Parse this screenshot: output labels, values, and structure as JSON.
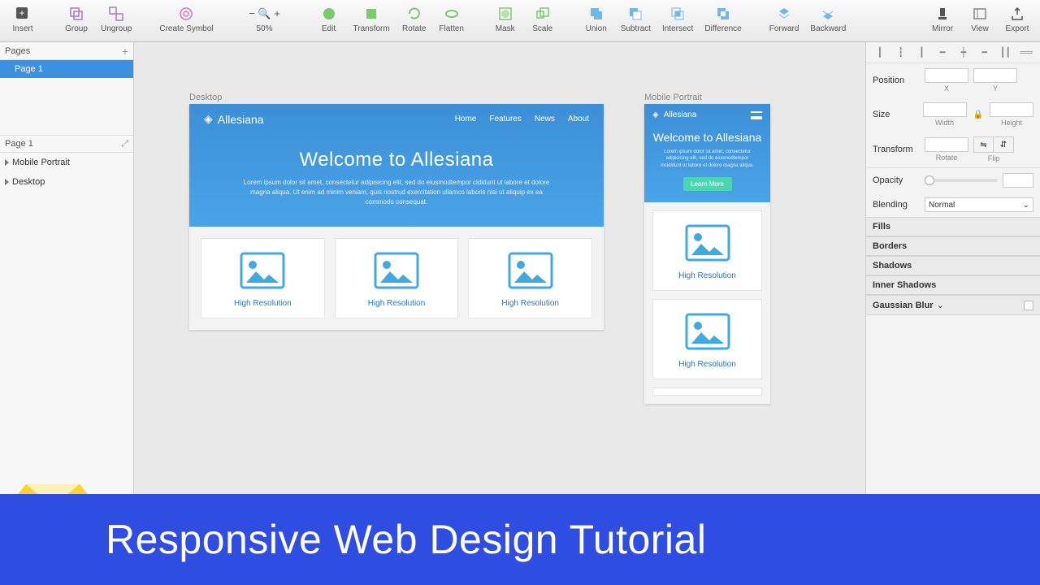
{
  "toolbar": {
    "insert": "Insert",
    "group": "Group",
    "ungroup": "Ungroup",
    "create_symbol": "Create Symbol",
    "zoom": "50%",
    "edit": "Edit",
    "transform": "Transform",
    "rotate": "Rotate",
    "flatten": "Flatten",
    "mask": "Mask",
    "scale": "Scale",
    "union": "Union",
    "subtract": "Subtract",
    "intersect": "Intersect",
    "difference": "Difference",
    "forward": "Forward",
    "backward": "Backward",
    "mirror": "Mirror",
    "view": "View",
    "export": "Export"
  },
  "left": {
    "pages_header": "Pages",
    "page1": "Page 1",
    "layers_header": "Page 1",
    "layer_mobile": "Mobile Portrait",
    "layer_desktop": "Desktop"
  },
  "canvas": {
    "desktop_label": "Desktop",
    "mobile_label": "Mobile Portrait",
    "brand": "Allesiana",
    "nav": {
      "home": "Home",
      "features": "Features",
      "news": "News",
      "about": "About"
    },
    "hero_title": "Welcome to Allesiana",
    "hero_body": "Lorem ipsum dolor sit amet, consectetur adipisicing elit, sed do eiusmodtempor cididunt ut labore et dolore magna aliqua. Ut enim ad minim veniam, quis nostrud exercitation ullamco laboris nisi ut aliquip ex ea commodo consequat.",
    "mobile_body": "Lorem ipsum dolor sit amet, consectetur adipisicing elit, sed do eiusmodtempor incididunt ut labore et dolore magna aliqua.",
    "learn_more": "Learn More",
    "card_caption": "High Resolution"
  },
  "inspector": {
    "position": "Position",
    "x": "X",
    "y": "Y",
    "size": "Size",
    "width": "Width",
    "height": "Height",
    "transform": "Transform",
    "rotate": "Rotate",
    "flip": "Flip",
    "opacity": "Opacity",
    "blending": "Blending",
    "blending_value": "Normal",
    "fills": "Fills",
    "borders": "Borders",
    "shadows": "Shadows",
    "inner_shadows": "Inner Shadows",
    "gaussian": "Gaussian Blur"
  },
  "banner": "Responsive Web Design Tutorial"
}
